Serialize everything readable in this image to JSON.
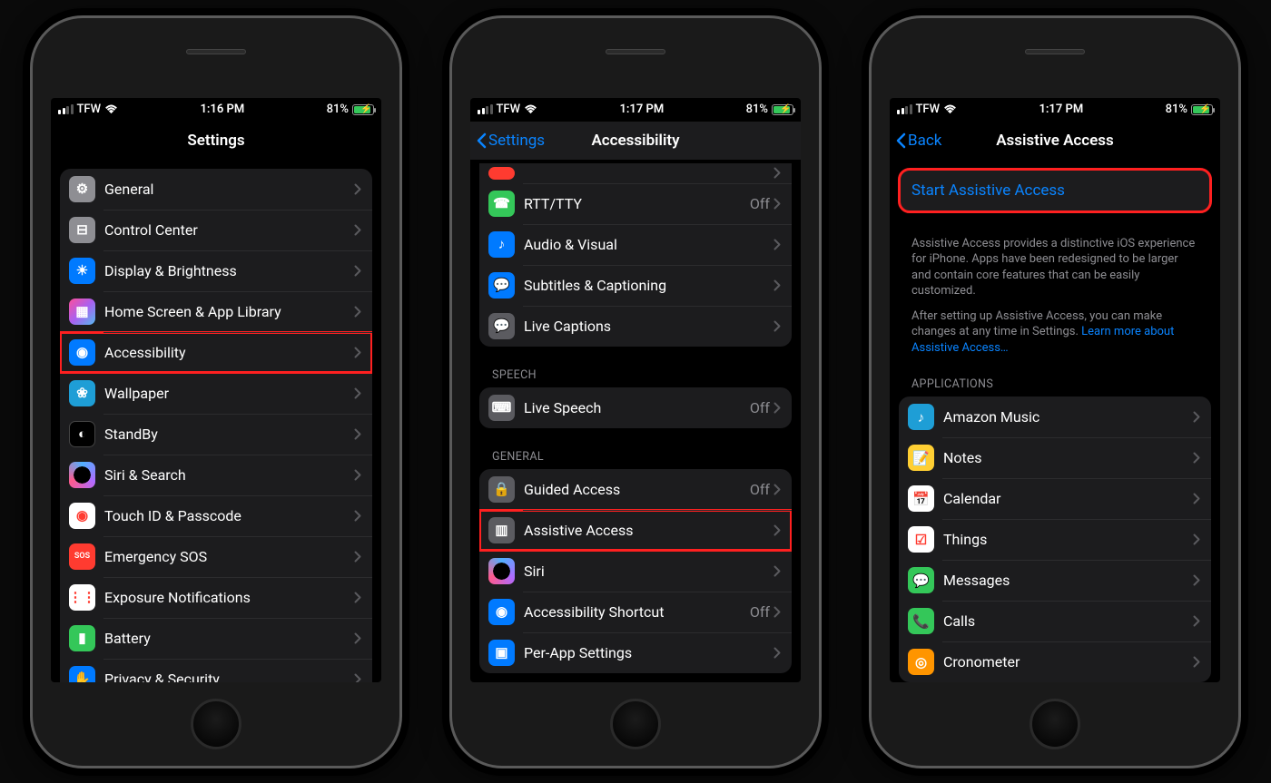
{
  "screens": [
    {
      "status": {
        "carrier": "TFW",
        "time": "1:16 PM",
        "battery_pct": "81%"
      },
      "nav": {
        "title": "Settings",
        "back": null
      },
      "rows": [
        {
          "icon": "gear",
          "iconbg": "bg-gray",
          "label": "General"
        },
        {
          "icon": "switches",
          "iconbg": "bg-gray",
          "label": "Control Center"
        },
        {
          "icon": "sun",
          "iconbg": "bg-blue",
          "label": "Display & Brightness"
        },
        {
          "icon": "grid",
          "iconbg": "bg-pink",
          "label": "Home Screen & App Library"
        },
        {
          "icon": "access",
          "iconbg": "bg-blue",
          "label": "Accessibility",
          "highlight": true
        },
        {
          "icon": "flower",
          "iconbg": "bg-teal",
          "label": "Wallpaper"
        },
        {
          "icon": "standby",
          "iconbg": "bg-black",
          "label": "StandBy"
        },
        {
          "icon": "siri",
          "iconbg": "siri-ic",
          "label": "Siri & Search"
        },
        {
          "icon": "finger",
          "iconbg": "bg-white",
          "label": "Touch ID & Passcode"
        },
        {
          "icon": "sos",
          "iconbg": "bg-red",
          "label": "Emergency SOS"
        },
        {
          "icon": "virus",
          "iconbg": "bg-white",
          "label": "Exposure Notifications"
        },
        {
          "icon": "battery",
          "iconbg": "bg-green",
          "label": "Battery"
        },
        {
          "icon": "hand",
          "iconbg": "bg-blue",
          "label": "Privacy & Security"
        }
      ]
    },
    {
      "status": {
        "carrier": "TFW",
        "time": "1:17 PM",
        "battery_pct": "81%"
      },
      "nav": {
        "title": "Accessibility",
        "back": "Settings"
      },
      "sections": [
        {
          "header": null,
          "rows": [
            {
              "icon": "rtt",
              "iconbg": "bg-green",
              "label": "RTT/TTY",
              "value": "Off"
            },
            {
              "icon": "ear",
              "iconbg": "bg-blue",
              "label": "Audio & Visual"
            },
            {
              "icon": "cc",
              "iconbg": "bg-blue",
              "label": "Subtitles & Captioning"
            },
            {
              "icon": "livecap",
              "iconbg": "bg-darkgray",
              "label": "Live Captions"
            }
          ]
        },
        {
          "header": "SPEECH",
          "rows": [
            {
              "icon": "keyboard",
              "iconbg": "bg-darkgray",
              "label": "Live Speech",
              "value": "Off"
            }
          ]
        },
        {
          "header": "GENERAL",
          "rows": [
            {
              "icon": "lock",
              "iconbg": "bg-darkgray",
              "label": "Guided Access",
              "value": "Off"
            },
            {
              "icon": "assist",
              "iconbg": "bg-darkgray",
              "label": "Assistive Access",
              "highlight": true
            },
            {
              "icon": "siri",
              "iconbg": "siri-ic",
              "label": "Siri"
            },
            {
              "icon": "access",
              "iconbg": "bg-blue",
              "label": "Accessibility Shortcut",
              "value": "Off"
            },
            {
              "icon": "perapp",
              "iconbg": "bg-blue",
              "label": "Per-App Settings"
            }
          ]
        }
      ],
      "cut_top": true
    },
    {
      "status": {
        "carrier": "TFW",
        "time": "1:17 PM",
        "battery_pct": "81%"
      },
      "nav": {
        "title": "Assistive Access",
        "back": "Back"
      },
      "start": {
        "label": "Start Assistive Access",
        "highlight": true
      },
      "desc1": "Assistive Access provides a distinctive iOS experience for iPhone. Apps have been redesigned to be larger and contain core features that can be easily customized.",
      "desc2_a": "After setting up Assistive Access, you can make changes at any time in Settings. ",
      "desc2_link": "Learn more about Assistive Access…",
      "apps_header": "APPLICATIONS",
      "apps": [
        {
          "icon": "amazon",
          "iconbg": "bg-teal",
          "label": "Amazon Music"
        },
        {
          "icon": "notes",
          "iconbg": "bg-yellow",
          "label": "Notes"
        },
        {
          "icon": "calendar",
          "iconbg": "bg-white",
          "label": "Calendar"
        },
        {
          "icon": "things",
          "iconbg": "bg-white",
          "label": "Things"
        },
        {
          "icon": "messages",
          "iconbg": "bg-green",
          "label": "Messages"
        },
        {
          "icon": "phone",
          "iconbg": "bg-green",
          "label": "Calls"
        },
        {
          "icon": "crono",
          "iconbg": "bg-orange",
          "label": "Cronometer"
        }
      ]
    }
  ],
  "icon_glyphs": {
    "gear": "⚙",
    "switches": "⊟",
    "sun": "☀",
    "grid": "▦",
    "access": "◉",
    "flower": "❀",
    "standby": "◐",
    "siri": "",
    "finger": "◉",
    "sos": "SOS",
    "virus": "⋮⋮",
    "battery": "▮",
    "hand": "✋",
    "rtt": "☎",
    "ear": "♪",
    "cc": "💬",
    "livecap": "💬",
    "keyboard": "⌨",
    "lock": "🔒",
    "assist": "▥",
    "perapp": "▣",
    "amazon": "♪",
    "notes": "📝",
    "calendar": "📅",
    "things": "☑",
    "messages": "💬",
    "phone": "📞",
    "crono": "◎"
  }
}
